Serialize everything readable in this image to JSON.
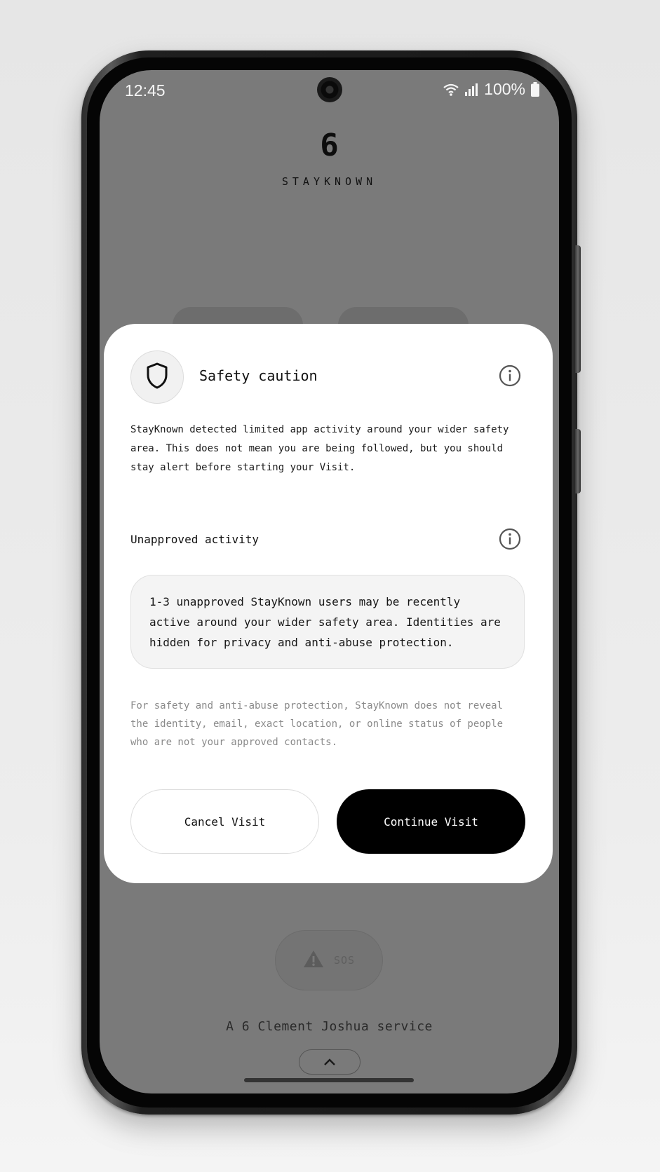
{
  "status_bar": {
    "time": "12:45",
    "battery": "100%",
    "icons": [
      "wifi-icon",
      "signal-icon",
      "battery-icon"
    ]
  },
  "app": {
    "logo_mark": "6",
    "logo_name": "STAYKNOWN",
    "sos_label": "SOS",
    "footer": "A 6 Clement Joshua service"
  },
  "dialog": {
    "title": "Safety caution",
    "description": "StayKnown detected limited app activity around your wider safety area. This does not mean you are being followed, but you should stay alert before starting your Visit.",
    "section_label": "Unapproved activity",
    "activity_text": "1-3 unapproved StayKnown users may be recently active around your wider safety area. Identities are hidden for privacy and anti-abuse protection.",
    "privacy_note": "For safety and anti-abuse protection, StayKnown does not reveal the identity, email, exact location, or online status of people who are not your approved contacts.",
    "cancel_label": "Cancel Visit",
    "continue_label": "Continue Visit"
  },
  "colors": {
    "overlay": "#7a7a7a",
    "dialog_bg": "#ffffff",
    "primary_button": "#000000"
  }
}
